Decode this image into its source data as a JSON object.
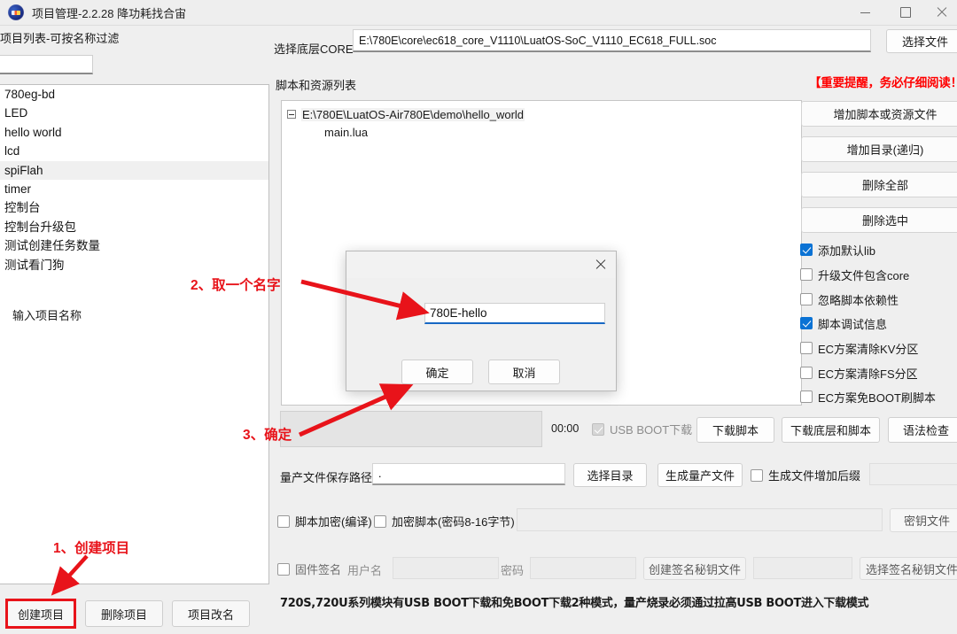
{
  "window": {
    "title": "项目管理-2.2.28 降功耗找合宙",
    "icon": "app-logo-icon",
    "controls": {
      "minimize": "—",
      "maximize": "□",
      "close": "✕"
    }
  },
  "left_panel": {
    "list_label": "项目列表-可按名称过滤",
    "filter_value": "",
    "filter_placeholder": "",
    "projects": [
      {
        "name": "780eg-bd",
        "selected": false
      },
      {
        "name": "LED",
        "selected": false
      },
      {
        "name": "hello world",
        "selected": false
      },
      {
        "name": "lcd",
        "selected": false
      },
      {
        "name": "spiFlah",
        "selected": true
      },
      {
        "name": "timer",
        "selected": false
      },
      {
        "name": "控制台",
        "selected": false
      },
      {
        "name": "控制台升级包",
        "selected": false
      },
      {
        "name": "测试创建任务数量",
        "selected": false
      },
      {
        "name": "测试看门狗",
        "selected": false
      }
    ],
    "buttons": {
      "create": "创建项目",
      "delete": "删除项目",
      "rename": "项目改名"
    }
  },
  "core": {
    "label": "选择底层CORE",
    "path": "E:\\780E\\core\\ec618_core_V1110\\LuatOS-SoC_V1110_EC618_FULL.soc",
    "choose_file_button": "选择文件"
  },
  "scripts": {
    "label": "脚本和资源列表",
    "important_note": "【重要提醒，务必仔细阅读！】",
    "tree": {
      "root": "E:\\780E\\LuatOS-Air780E\\demo\\hello_world",
      "children": [
        "main.lua"
      ]
    }
  },
  "right_panel": {
    "buttons": [
      {
        "label": "增加脚本或资源文件"
      },
      {
        "label": "增加目录(递归)"
      },
      {
        "label": "删除全部"
      },
      {
        "label": "删除选中"
      }
    ],
    "checkboxes": [
      {
        "label": "添加默认lib",
        "checked": true
      },
      {
        "label": "升级文件包含core",
        "checked": false
      },
      {
        "label": "忽略脚本依赖性",
        "checked": false
      },
      {
        "label": "脚本调试信息",
        "checked": true
      },
      {
        "label": "EC方案清除KV分区",
        "checked": false
      },
      {
        "label": "EC方案清除FS分区",
        "checked": false
      },
      {
        "label": "EC方案免BOOT刷脚本",
        "checked": false
      }
    ]
  },
  "download_row": {
    "timer": "00:00",
    "usb_boot_label": "USB BOOT下载",
    "usb_boot_checked": true,
    "buttons": {
      "download_script": "下载脚本",
      "download_core_script": "下载底层和脚本",
      "syntax_check": "语法检查"
    }
  },
  "mass_production": {
    "path_label": "量产文件保存路径",
    "path_value": ".",
    "choose_dir_button": "选择目录",
    "generate_button": "生成量产文件",
    "suffix_checkbox": "生成文件增加后缀",
    "suffix_checked": false,
    "suffix_value": ""
  },
  "encryption": {
    "compile_checkbox": "脚本加密(编译)",
    "compile_checked": false,
    "script_checkbox": "加密脚本(密码8-16字节)",
    "script_checked": false,
    "password_value": "",
    "key_file_button": "密钥文件"
  },
  "signature": {
    "checkbox": "固件签名",
    "checked": false,
    "user_label": "用户名",
    "user_value": "",
    "pass_label": "密码",
    "pass_value": "",
    "create_key_button": "创建签名秘钥文件",
    "key_value": "",
    "choose_key_button": "选择签名秘钥文件"
  },
  "bottom_note": "720S,720U系列模块有USB BOOT下载和免BOOT下载2种模式，量产烧录必须通过拉高USB BOOT进入下载模式",
  "dialog": {
    "close_icon": "✕",
    "field_label": "输入项目名称",
    "input_value": "780E-hello",
    "ok_button": "确定",
    "cancel_button": "取消"
  },
  "annotations": [
    {
      "id": "1",
      "text": "1、创建项目"
    },
    {
      "id": "2",
      "text": "2、取一个名字"
    },
    {
      "id": "3",
      "text": "3、确定"
    }
  ],
  "colors": {
    "annotation_red": "#e8131a",
    "warning_red": "#ff0000",
    "accent_blue": "#0a72d4",
    "dialog_underline": "#1768c4"
  }
}
